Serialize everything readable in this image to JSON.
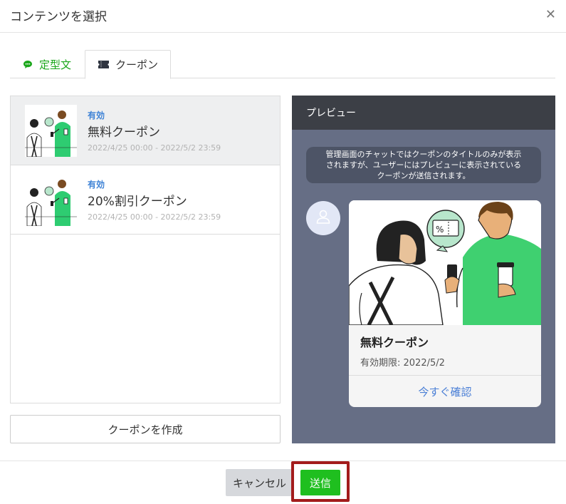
{
  "dialog": {
    "title": "コンテンツを選択",
    "close_icon": "close-icon"
  },
  "tabs": [
    {
      "label": "定型文",
      "icon": "chat-bubble-icon",
      "color": "#1aa71a"
    },
    {
      "label": "クーポン",
      "icon": "ticket-icon",
      "active": true
    }
  ],
  "coupons": [
    {
      "status": "有効",
      "name": "無料クーポン",
      "period": "2022/4/25 00:00 - 2022/5/2 23:59",
      "selected": true
    },
    {
      "status": "有効",
      "name": "20%割引クーポン",
      "period": "2022/4/25 00:00 - 2022/5/2 23:59",
      "selected": false
    }
  ],
  "create_button": "クーポンを作成",
  "preview": {
    "header": "プレビュー",
    "notice_line1": "管理画面のチャットではクーポンのタイトルのみが表示",
    "notice_line2": "されますが、ユーザーにはプレビューに表示されている",
    "notice_line3": "クーポンが送信されます。",
    "card": {
      "title": "無料クーポン",
      "expiry": "有効期限: 2022/5/2",
      "action": "今すぐ確認"
    }
  },
  "footer": {
    "cancel": "キャンセル",
    "send": "送信"
  },
  "colors": {
    "accent_green": "#1fbf1f",
    "link_blue": "#4a7fd6",
    "highlight_red": "#a31c1c",
    "preview_bg": "#666e85"
  }
}
